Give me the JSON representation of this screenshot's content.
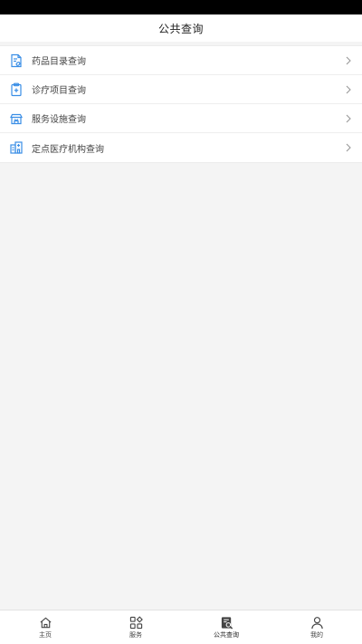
{
  "header": {
    "title": "公共查询"
  },
  "list": {
    "items": [
      {
        "label": "药品目录查询",
        "icon": "drug-catalog-icon"
      },
      {
        "label": "诊疗项目查询",
        "icon": "treatment-item-icon"
      },
      {
        "label": "服务设施查询",
        "icon": "service-facility-icon"
      },
      {
        "label": "定点医疗机构查询",
        "icon": "medical-institution-icon"
      }
    ]
  },
  "tabbar": {
    "tabs": [
      {
        "label": "主页",
        "icon": "home-icon"
      },
      {
        "label": "服务",
        "icon": "services-grid-icon"
      },
      {
        "label": "公共查询",
        "icon": "public-query-icon",
        "active": true
      },
      {
        "label": "我的",
        "icon": "profile-icon"
      }
    ]
  },
  "colors": {
    "accent": "#3a8ee6",
    "background": "#f4f4f4"
  }
}
